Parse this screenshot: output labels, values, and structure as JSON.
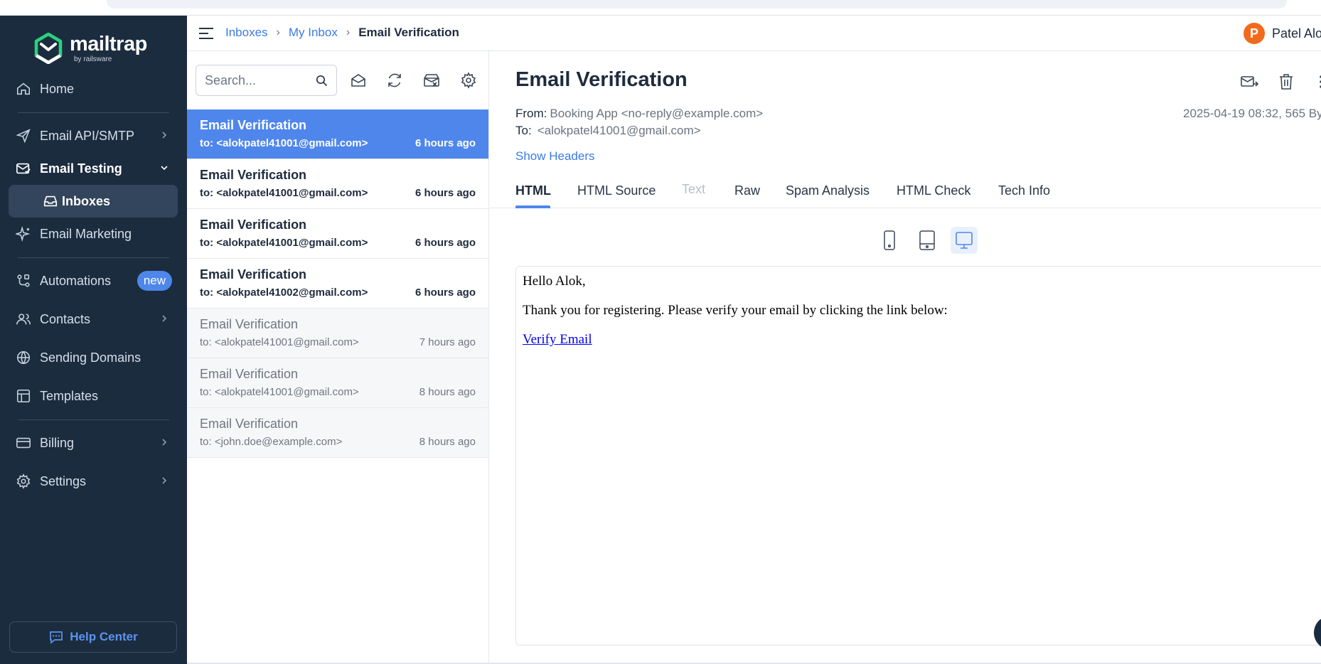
{
  "sidebar": {
    "brand": {
      "name": "mailtrap",
      "sub": "by railsware"
    },
    "items": [
      {
        "label": "Home",
        "icon": "home-icon"
      },
      {
        "label": "Email API/SMTP",
        "icon": "send-icon"
      },
      {
        "label": "Email Testing",
        "icon": "email-testing-icon"
      },
      {
        "label": "Inboxes",
        "icon": "inbox-icon"
      },
      {
        "label": "Email Marketing",
        "icon": "sparkle-icon"
      },
      {
        "label": "Automations",
        "icon": "automation-icon",
        "badge": "new"
      },
      {
        "label": "Contacts",
        "icon": "contacts-icon"
      },
      {
        "label": "Sending Domains",
        "icon": "globe-icon"
      },
      {
        "label": "Templates",
        "icon": "template-icon"
      },
      {
        "label": "Billing",
        "icon": "billing-icon"
      },
      {
        "label": "Settings",
        "icon": "gear-icon"
      }
    ],
    "help_center": "Help Center"
  },
  "header": {
    "breadcrumb": [
      "Inboxes",
      "My Inbox",
      "Email Verification"
    ],
    "user": {
      "initial": "P",
      "name": "Patel Alo"
    }
  },
  "list": {
    "search_placeholder": "Search...",
    "messages": [
      {
        "subject": "Email Verification",
        "to": "to: <alokpatel41001@gmail.com>",
        "time": "6 hours ago",
        "state": "selected"
      },
      {
        "subject": "Email Verification",
        "to": "to: <alokpatel41001@gmail.com>",
        "time": "6 hours ago",
        "state": "unread"
      },
      {
        "subject": "Email Verification",
        "to": "to: <alokpatel41001@gmail.com>",
        "time": "6 hours ago",
        "state": "unread"
      },
      {
        "subject": "Email Verification",
        "to": "to: <alokpatel41002@gmail.com>",
        "time": "6 hours ago",
        "state": "unread"
      },
      {
        "subject": "Email Verification",
        "to": "to: <alokpatel41001@gmail.com>",
        "time": "7 hours ago",
        "state": "read"
      },
      {
        "subject": "Email Verification",
        "to": "to: <alokpatel41001@gmail.com>",
        "time": "8 hours ago",
        "state": "read"
      },
      {
        "subject": "Email Verification",
        "to": "to: <john.doe@example.com>",
        "time": "8 hours ago",
        "state": "read"
      }
    ]
  },
  "detail": {
    "title": "Email Verification",
    "from_label": "From:",
    "from_value": "Booking App <no-reply@example.com>",
    "to_label": "To:",
    "to_value": "<alokpatel41001@gmail.com>",
    "date_info": "2025-04-19 08:32, 565 By",
    "show_headers": "Show Headers",
    "tabs": [
      "HTML",
      "HTML Source",
      "Text",
      "Raw",
      "Spam Analysis",
      "HTML Check",
      "Tech Info"
    ],
    "active_tab": "HTML",
    "disabled_tab": "Text",
    "preview": {
      "greeting": "Hello Alok,",
      "body": "Thank you for registering. Please verify your email by clicking the link below:",
      "link": "Verify Email"
    }
  },
  "colors": {
    "sidebar_bg": "#1c2c3f",
    "accent": "#4f86ec",
    "link": "#3b7be6",
    "avatar": "#f26b1d"
  }
}
